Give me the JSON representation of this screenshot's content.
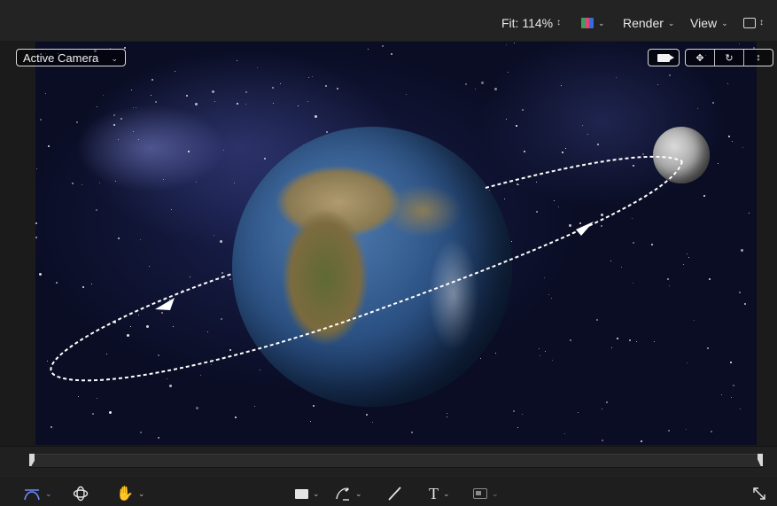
{
  "topbar": {
    "fit_label": "Fit: 114%",
    "render_label": "Render",
    "view_label": "View"
  },
  "viewer": {
    "camera_select": "Active Camera"
  },
  "icons": {
    "updown": "updown-icon",
    "chevron": "chevron-down-icon",
    "color_channels": "color-channels-icon",
    "layout": "layout-icon",
    "camera": "camera-icon",
    "pan": "pan-move-icon",
    "orbit": "orbit-icon",
    "dolly": "dolly-icon",
    "bezier": "bezier-tool-icon",
    "orbit_tool": "orbit-3d-icon",
    "hand": "hand-icon",
    "rectangle": "rectangle-icon",
    "pen": "pen-icon",
    "brush": "paint-stroke-icon",
    "text": "text-tool-icon",
    "mask": "mask-icon",
    "expand": "expand-icon"
  },
  "toolbar": {
    "text_tool_glyph": "T"
  },
  "colors": {
    "accent": "#6f8cff",
    "background": "#1b1b1b"
  }
}
